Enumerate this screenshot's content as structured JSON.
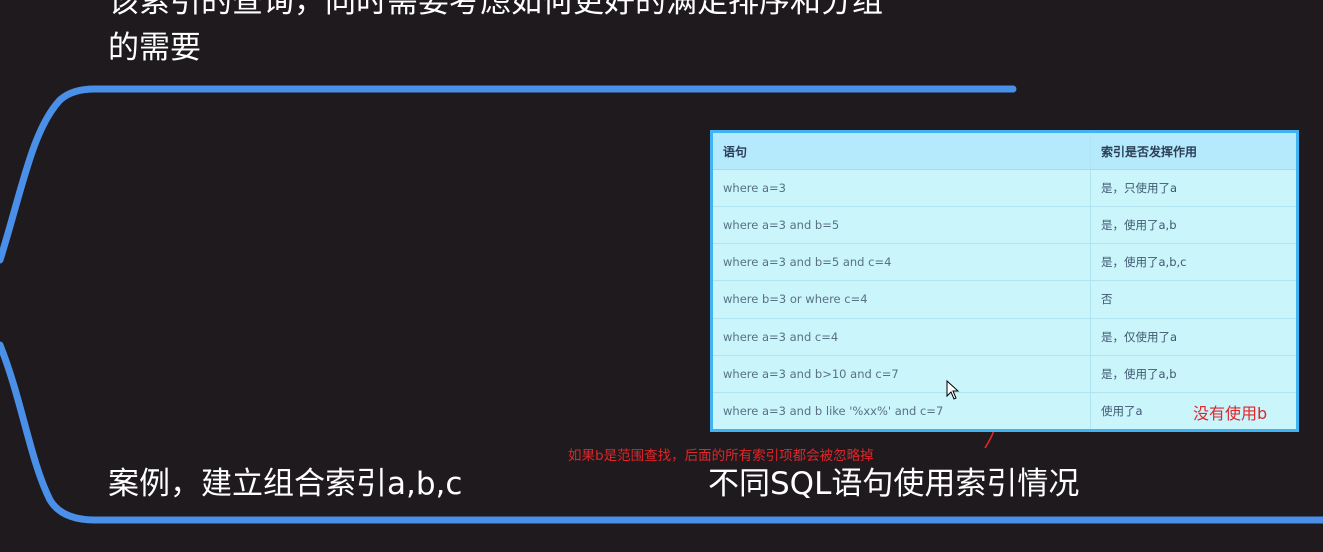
{
  "heading": {
    "line1": "该索引的查询，同时需要考虑如何更好的满足排序和分组",
    "line2": "的需要"
  },
  "captions": {
    "left": "案例，建立组合索引a,b,c",
    "right": "不同SQL语句使用索引情况"
  },
  "table": {
    "headers": [
      "语句",
      "索引是否发挥作用"
    ],
    "rows": [
      [
        "where a=3",
        "是，只使用了a"
      ],
      [
        "where a=3 and b=5",
        "是，使用了a,b"
      ],
      [
        "where a=3 and b=5 and c=4",
        "是，使用了a,b,c"
      ],
      [
        "where b=3 or where c=4",
        "否"
      ],
      [
        "where a=3 and c=4",
        "是，仅使用了a"
      ],
      [
        "where a=3 and b>10 and c=7",
        "是，使用了a,b"
      ],
      [
        "where a=3 and b like '%xx%' and c=7",
        "使用了a"
      ]
    ]
  },
  "annotations": {
    "b_not_used": "没有使用b",
    "range_note": "如果b是范围查找，后面的所有索引项都会被忽略掉"
  },
  "colors": {
    "background": "#1e1a1d",
    "frame_line": "#4a8fe8",
    "table_border": "#41b2f4",
    "table_bg": "#c9f5fb",
    "annotation": "#e0262a"
  }
}
